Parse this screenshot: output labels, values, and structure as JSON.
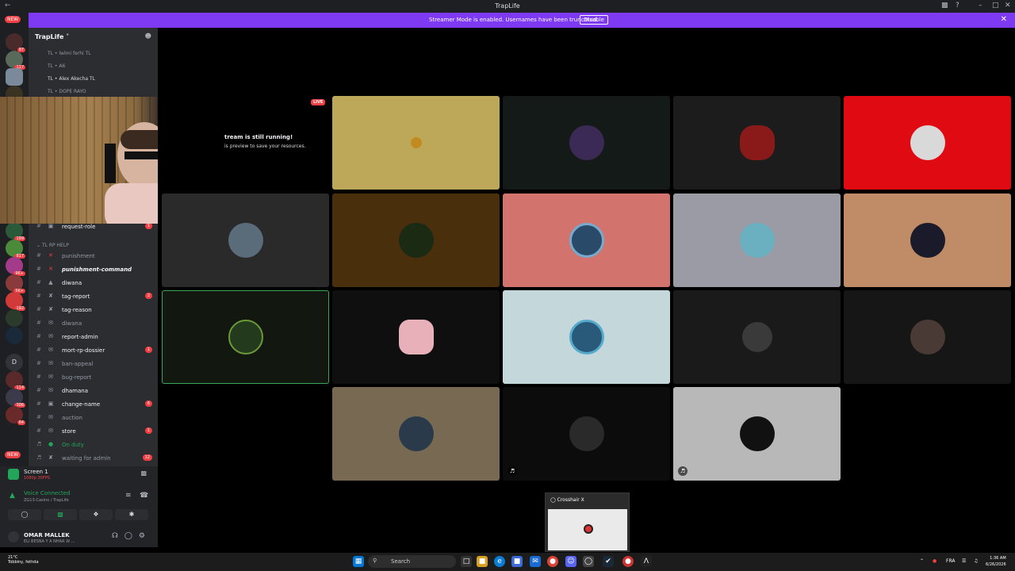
{
  "titlebar": {
    "title": "TrapLife"
  },
  "banner": {
    "message": "Streamer Mode is enabled. Usernames have been truncated.",
    "disable": "Disable"
  },
  "servers": {
    "new_top": "NEW",
    "new_bottom": "NEW",
    "badges": [
      "97",
      "117",
      "199",
      "817",
      "9K+",
      "5K+",
      "192",
      "114",
      "306",
      "64"
    ],
    "letter_d": "D"
  },
  "sidebar": {
    "guild_name": "TrapLife",
    "voice_users": [
      {
        "prefix": "TL",
        "name": "lwlmi ferhi",
        "tag": "TL"
      },
      {
        "prefix": "TL",
        "name": "A6",
        "tag": ""
      },
      {
        "prefix": "TL",
        "name": "Alex Akecha",
        "tag": "TL"
      },
      {
        "prefix": "TL",
        "name": "DOPE RAYO",
        "tag": ""
      }
    ],
    "channels": [
      {
        "name": "request-role",
        "count": "1",
        "bright": true
      },
      {
        "name": "punishment",
        "count": "",
        "bright": false
      },
      {
        "name": "punishment-command",
        "count": "",
        "bright": true
      },
      {
        "name": "diwana",
        "count": "",
        "bright": true
      },
      {
        "name": "tag-report",
        "count": "2",
        "bright": true
      },
      {
        "name": "tag-reason",
        "count": "",
        "bright": true
      },
      {
        "name": "diwana",
        "count": "",
        "bright": false
      },
      {
        "name": "report-admin",
        "count": "",
        "bright": true
      },
      {
        "name": "mort-rp-dossier",
        "count": "1",
        "bright": true
      },
      {
        "name": "ban-appeal",
        "count": "",
        "bright": false
      },
      {
        "name": "bug-report",
        "count": "",
        "bright": false
      },
      {
        "name": "dhamana",
        "count": "",
        "bright": true
      },
      {
        "name": "change-name",
        "count": "6",
        "bright": true
      },
      {
        "name": "auction",
        "count": "",
        "bright": false
      },
      {
        "name": "store",
        "count": "1",
        "bright": true
      },
      {
        "name": "On duty",
        "count": "",
        "bright": false
      },
      {
        "name": "waiting for admin",
        "count": "12",
        "bright": false
      }
    ],
    "category": "TL RP HELP"
  },
  "voice_panel": {
    "screen": "Screen 1",
    "screen_sub": "1080p 30FPS",
    "connected": "Voice Connected",
    "channel": "ZG13-Casino / TrapLife",
    "username": "OMAR MALLEK",
    "status": "ELI BESNA Y A NHAR W ..."
  },
  "stage": {
    "live": "LIVE",
    "stream_title": "tream is still running!",
    "stream_sub": "is preview to save your resources."
  },
  "popup": {
    "title": "Crosshair X"
  },
  "taskbar": {
    "search": "Search",
    "weather_temp": "21°C",
    "weather_desc": "Tobbiny, fethda",
    "lang": "FRA",
    "time": "1:36 AM",
    "date": "6/26/2026"
  },
  "colors": {
    "accent": "#7e3af2",
    "online": "#23a55a",
    "mention": "#f23f43"
  }
}
